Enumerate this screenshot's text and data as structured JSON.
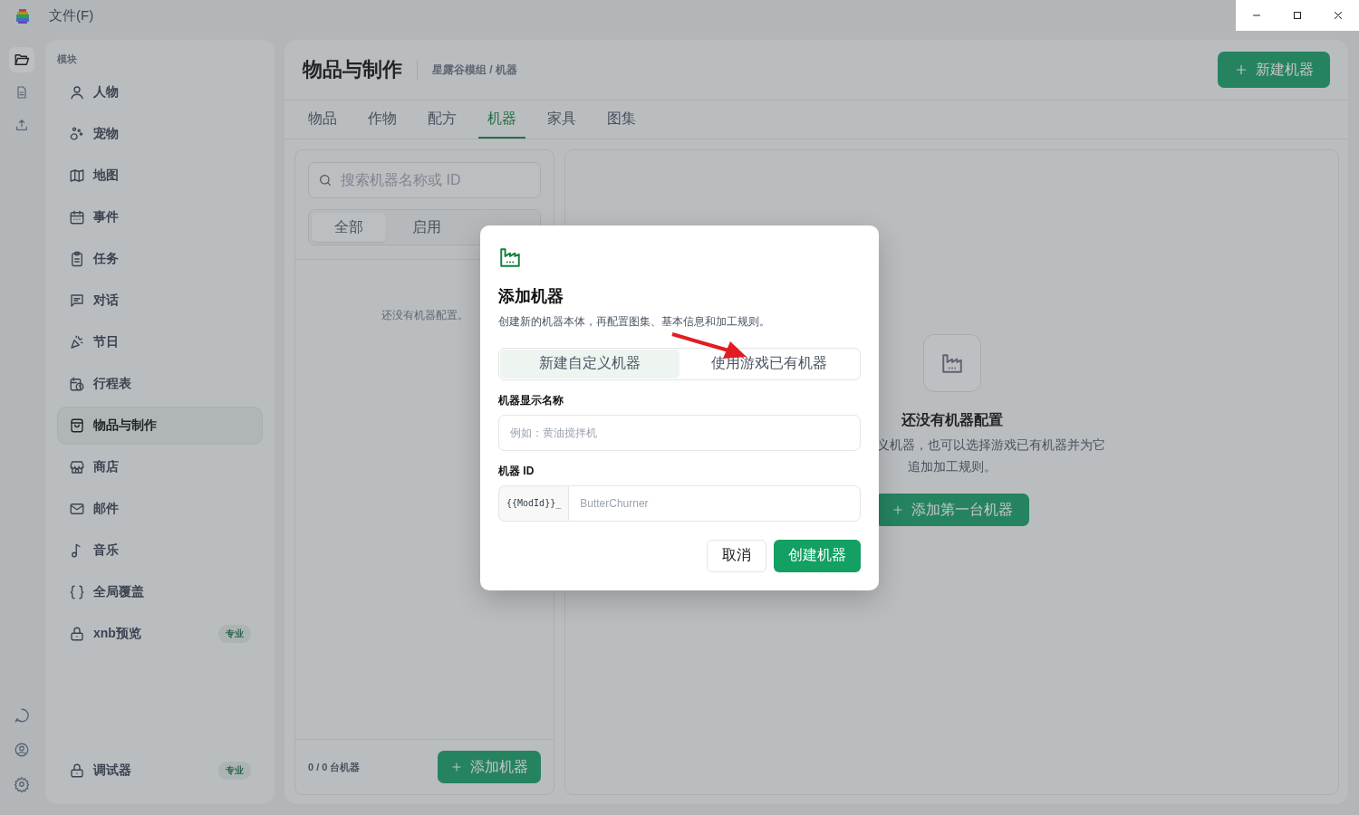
{
  "menu": {
    "file": "文件(F)"
  },
  "sidebar": {
    "heading": "模块",
    "items": [
      {
        "label": "人物",
        "selected": false
      },
      {
        "label": "宠物",
        "selected": false
      },
      {
        "label": "地图",
        "selected": false
      },
      {
        "label": "事件",
        "selected": false
      },
      {
        "label": "任务",
        "selected": false
      },
      {
        "label": "对话",
        "selected": false
      },
      {
        "label": "节日",
        "selected": false
      },
      {
        "label": "行程表",
        "selected": false
      },
      {
        "label": "物品与制作",
        "selected": true
      },
      {
        "label": "商店",
        "selected": false
      },
      {
        "label": "邮件",
        "selected": false
      },
      {
        "label": "音乐",
        "selected": false
      },
      {
        "label": "全局覆盖",
        "selected": false
      },
      {
        "label": "xnb预览",
        "selected": false,
        "badge": "专业"
      }
    ],
    "footer_item": {
      "label": "调试器",
      "badge": "专业"
    }
  },
  "header": {
    "title": "物品与制作",
    "breadcrumb": "星露谷模组 / 机器",
    "new_button": "新建机器"
  },
  "tabs": [
    {
      "label": "物品",
      "selected": false
    },
    {
      "label": "作物",
      "selected": false
    },
    {
      "label": "配方",
      "selected": false
    },
    {
      "label": "机器",
      "selected": true
    },
    {
      "label": "家具",
      "selected": false
    },
    {
      "label": "图集",
      "selected": false
    }
  ],
  "list_panel": {
    "search": {
      "placeholder": "搜索机器名称或 ID"
    },
    "filters": [
      {
        "label": "全部",
        "selected": true
      },
      {
        "label": "启用",
        "selected": false
      }
    ],
    "empty_text": "还没有机器配置。",
    "count": "0 / 0 台机器",
    "add_button": "添加机器"
  },
  "empty_state": {
    "title": "还没有机器配置",
    "description_lines": [
      "义机器，也可以选择游戏已有机器并为它",
      "追加加工规则。"
    ],
    "button": "添加第一台机器"
  },
  "dialog": {
    "title": "添加机器",
    "description": "创建新的机器本体，再配置图集、基本信息和加工规则。",
    "modes": [
      {
        "label": "新建自定义机器",
        "selected": true
      },
      {
        "label": "使用游戏已有机器",
        "selected": false
      }
    ],
    "name_label": "机器显示名称",
    "name_placeholder": "例如：黄油搅拌机",
    "id_label": "机器 ID",
    "id_prefix": "{{ModId}}_",
    "id_placeholder": "ButterChurner",
    "cancel": "取消",
    "create": "创建机器"
  }
}
